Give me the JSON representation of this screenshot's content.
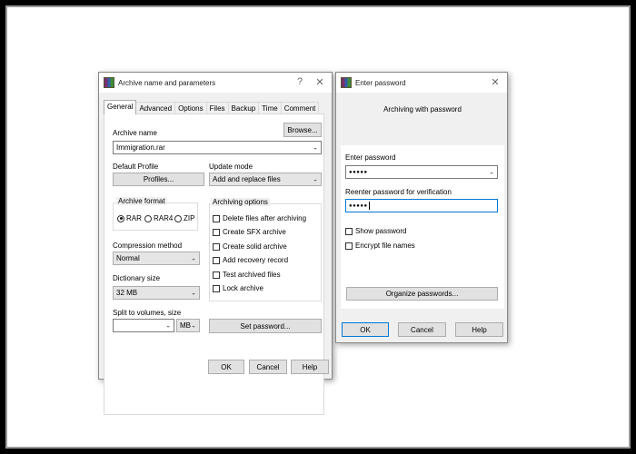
{
  "archive_dialog": {
    "title": "Archive name and parameters",
    "help_glyph": "?",
    "close_glyph": "✕",
    "tabs": [
      {
        "label": "General",
        "active": true
      },
      {
        "label": "Advanced"
      },
      {
        "label": "Options"
      },
      {
        "label": "Files"
      },
      {
        "label": "Backup"
      },
      {
        "label": "Time"
      },
      {
        "label": "Comment"
      }
    ],
    "archive_name_label": "Archive name",
    "browse_label": "Browse...",
    "archive_name_value": "Immigration.rar",
    "default_profile_label": "Default Profile",
    "profiles_label": "Profiles...",
    "update_mode_label": "Update mode",
    "update_mode_value": "Add and replace files",
    "archive_format_label": "Archive format",
    "formats": [
      {
        "label": "RAR",
        "selected": true
      },
      {
        "label": "RAR4",
        "selected": false
      },
      {
        "label": "ZIP",
        "selected": false
      }
    ],
    "compression_method_label": "Compression method",
    "compression_method_value": "Normal",
    "dictionary_size_label": "Dictionary size",
    "dictionary_size_value": "32 MB",
    "split_label": "Split to volumes, size",
    "split_value": "",
    "split_unit": "MB",
    "archiving_options_label": "Archiving options",
    "options": [
      {
        "label": "Delete files after archiving",
        "checked": false
      },
      {
        "label": "Create SFX archive",
        "checked": false
      },
      {
        "label": "Create solid archive",
        "checked": false
      },
      {
        "label": "Add recovery record",
        "checked": false
      },
      {
        "label": "Test archived files",
        "checked": false
      },
      {
        "label": "Lock archive",
        "checked": false
      }
    ],
    "set_password_label": "Set password...",
    "ok_label": "OK",
    "cancel_label": "Cancel",
    "help_label": "Help"
  },
  "password_dialog": {
    "title": "Enter password",
    "close_glyph": "✕",
    "subtitle": "Archiving with password",
    "enter_password_label": "Enter password",
    "enter_password_value": "●●●●●",
    "reenter_label": "Reenter password for verification",
    "reenter_value": "●●●●●",
    "show_password_label": "Show password",
    "encrypt_names_label": "Encrypt file names",
    "organize_label": "Organize passwords...",
    "ok_label": "OK",
    "cancel_label": "Cancel",
    "help_label": "Help"
  },
  "icons": {
    "app": "winrar-icon",
    "dropdown": "chevron-down-icon",
    "close": "close-icon",
    "help": "help-icon"
  }
}
